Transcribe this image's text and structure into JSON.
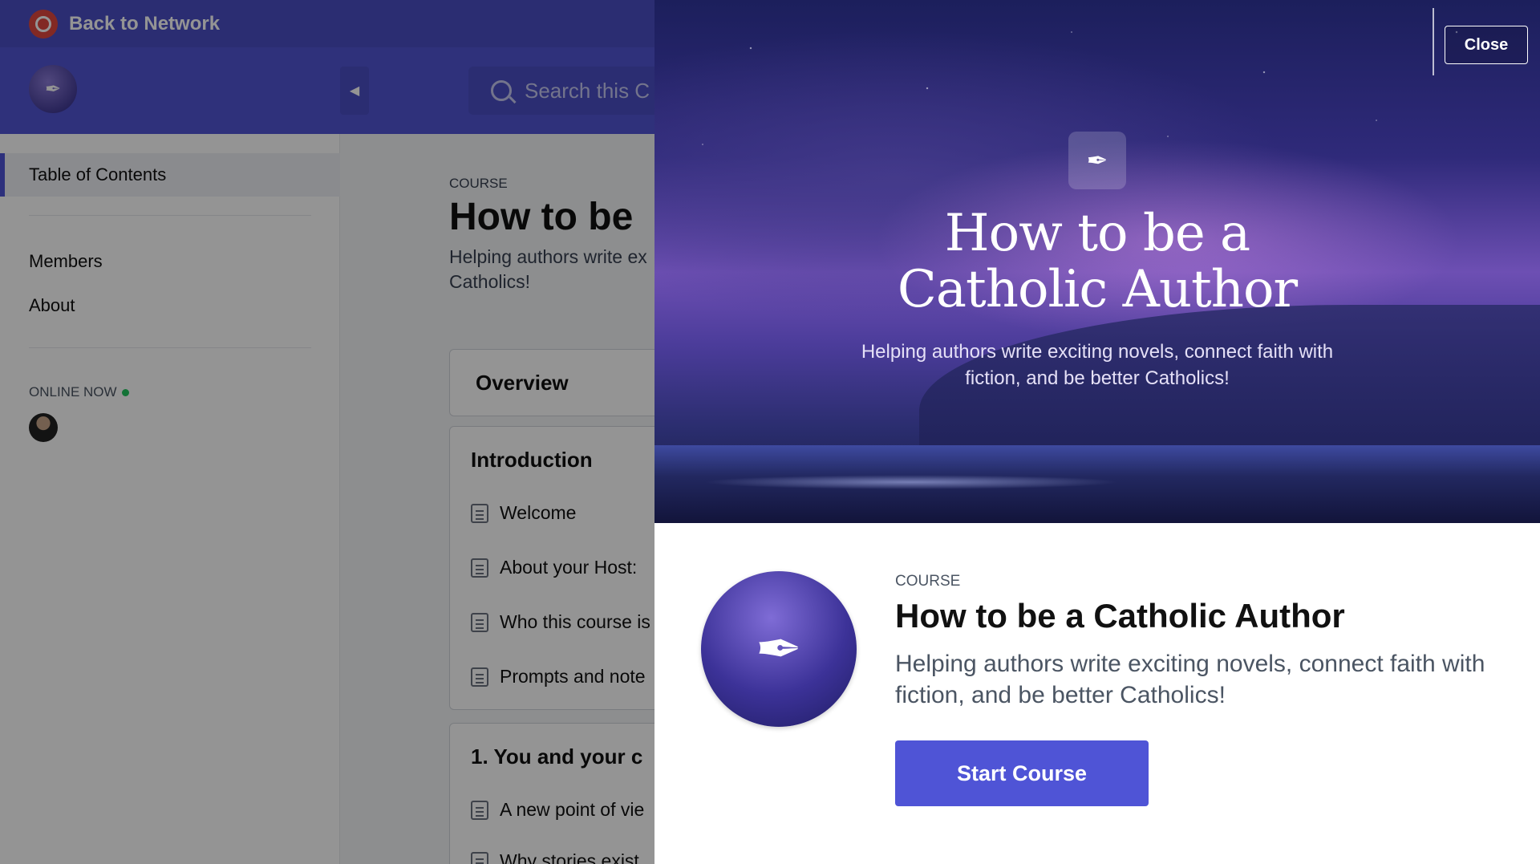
{
  "network": {
    "back_label": "Back to Network"
  },
  "header": {
    "search_placeholder": "Search this C"
  },
  "sidebar": {
    "active_item": "Table of Contents",
    "items": [
      "Members",
      "About"
    ],
    "online_label": "ONLINE NOW"
  },
  "course_page": {
    "label": "COURSE",
    "title": "How to be",
    "subtitle": "Helping authors write ex Catholics!",
    "overview_label": "Overview",
    "sections": [
      {
        "title": "Introduction",
        "lessons": [
          "Welcome",
          "About your Host:",
          "Who this course is",
          "Prompts and note"
        ]
      },
      {
        "title": "1. You and your c",
        "lessons": [
          "A new point of vie",
          "Why stories exist"
        ]
      }
    ]
  },
  "modal": {
    "close_label": "Close",
    "hero_title_line1": "How to be a",
    "hero_title_line2": "Catholic Author",
    "hero_subtitle": "Helping authors write exciting novels, connect faith with fiction, and be better Catholics!",
    "course_label": "COURSE",
    "title": "How to be a Catholic Author",
    "subtitle": "Helping authors write exciting novels, connect faith with fiction, and be better Catholics!",
    "start_label": "Start Course"
  },
  "colors": {
    "brand": "#4f54d6",
    "online": "#22c55e"
  }
}
